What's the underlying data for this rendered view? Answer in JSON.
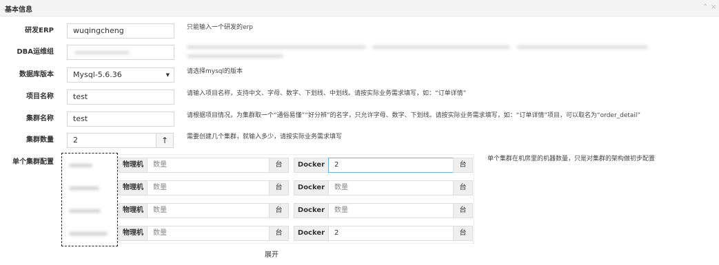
{
  "panel": {
    "title": "基本信息",
    "collapse_icon": "chevron-up-icon",
    "close_icon": "close-icon",
    "collapse_glyph": "⌃",
    "close_glyph": "×"
  },
  "form": {
    "erp": {
      "label": "研发ERP",
      "value": "wuqingcheng",
      "hint": "只能输入一个研发的erp"
    },
    "dba": {
      "label": "DBA运维组"
    },
    "db_version": {
      "label": "数据库版本",
      "value": "Mysql-5.6.36",
      "caret": "▼",
      "hint": "请选择mysql的版本"
    },
    "project": {
      "label": "项目名称",
      "value": "test",
      "hint": "请输入项目名称，支持中文、字母、数字、下划线、中划线。请按实际业务需求填写，如：“订单详情”"
    },
    "cluster_name": {
      "label": "集群名称",
      "value": "test",
      "hint": "请根据项目情况，为集群取一个“通俗易懂”“好分辨”的名字，只允许字母、数字、下划线。请按实际业务需求填写，如：“订单详情”项目，可以取名为“order_detail”"
    },
    "cluster_count": {
      "label": "集群数量",
      "value": "2",
      "stepper_glyph": "↑",
      "hint": "需要创建几个集群，就输入多少，请按实际业务需求填写"
    },
    "single_cluster": {
      "label": "单个集群配置",
      "hint": "单个集群在机房里的机器数量，只是对集群的架构做初步配置",
      "physical_label": "物理机",
      "docker_label": "Docker",
      "unit": "台",
      "placeholder": "数量",
      "rows": [
        {
          "physical": "",
          "docker": "2"
        },
        {
          "physical": "",
          "docker": ""
        },
        {
          "physical": "",
          "docker": ""
        },
        {
          "physical": "",
          "docker": "2"
        }
      ]
    },
    "expand_label": "展开"
  }
}
